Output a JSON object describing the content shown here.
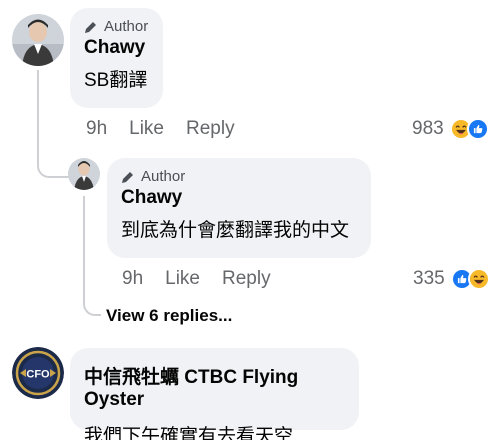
{
  "comment1": {
    "badge": "Author",
    "name": "Chawy",
    "text": "SB翻譯",
    "time": "9h",
    "like": "Like",
    "reply": "Reply",
    "reactions": "983"
  },
  "reply1": {
    "badge": "Author",
    "name": "Chawy",
    "text": "到底為什會麼翻譯我的中文",
    "time": "9h",
    "like": "Like",
    "reply": "Reply",
    "reactions": "335"
  },
  "view_replies": "View 6 replies...",
  "comment2": {
    "name": "中信飛牡蠣 CTBC Flying Oyster",
    "text": "我們下午確實有去看天空",
    "avatar_text": "CFO"
  },
  "colors": {
    "bubble": "#f0f2f5",
    "like_blue": "#1877f2",
    "haha_yellow": "#f7b928",
    "meta_gray": "#65676b"
  },
  "icons": [
    "author-pen-icon",
    "haha-reaction-icon",
    "like-reaction-icon"
  ]
}
